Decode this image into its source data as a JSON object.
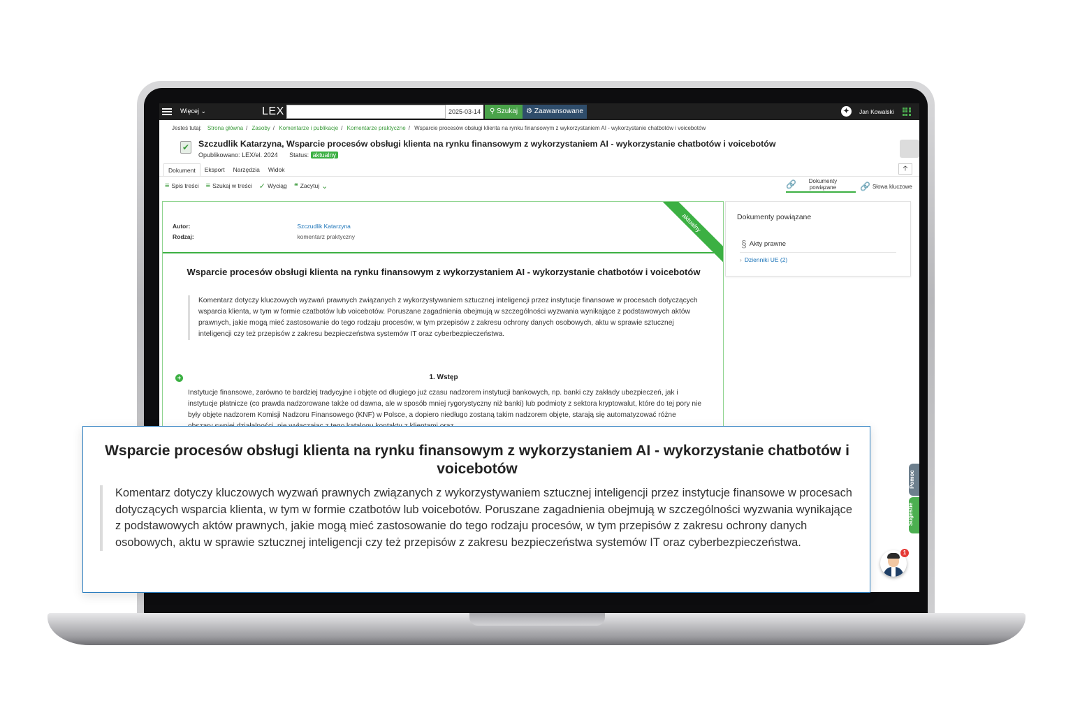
{
  "topbar": {
    "more_label": "Więcej ⌄",
    "logo": "LEX",
    "search_value": "",
    "date": "2025-03-14",
    "search_button": "Szukaj",
    "advanced_button": "Zaawansowane",
    "accessibility_icon": "accessibility-icon",
    "user_name": "Jan Kowalski",
    "apps_icon": "apps-grid-icon",
    "accent_color": "#4aa34a"
  },
  "breadcrumb": {
    "prefix": "Jesteś tutaj:",
    "items": [
      "Strona główna",
      "Zasoby",
      "Komentarze i publikacje",
      "Komentarze praktyczne"
    ],
    "current": "Wsparcie procesów obsługi klienta na rynku finansowym z wykorzystaniem AI - wykorzystanie chatbotów i voicebotów"
  },
  "document": {
    "header_title": "Szczudlik Katarzyna, Wsparcie procesów obsługi klienta na rynku finansowym z wykorzystaniem AI - wykorzystanie chatbotów i voicebotów",
    "published_label": "Opublikowano:",
    "published_value": "LEX/el. 2024",
    "status_label": "Status:",
    "status_value": "aktualny",
    "ribbon": "aktualny",
    "tabs": [
      "Dokument",
      "Eksport",
      "Narzędzia",
      "Widok"
    ],
    "toolbar": [
      "Spis treści",
      "Szukaj w treści",
      "Wyciąg",
      "Zacytuj"
    ],
    "right_tools": [
      "Dokumenty powiązane",
      "Słowa kluczowe"
    ],
    "author_label": "Autor:",
    "author_value": "Szczudlik Katarzyna",
    "kind_label": "Rodzaj:",
    "kind_value": "komentarz praktyczny",
    "title": "Wsparcie procesów obsługi klienta na rynku finansowym z wykorzystaniem AI - wykorzystanie chatbotów i voicebotów",
    "abstract": "Komentarz dotyczy kluczowych wyzwań prawnych związanych z wykorzystywaniem sztucznej inteligencji przez instytucje finansowe w procesach dotyczących wsparcia klienta, w tym w formie czatbotów lub voicebotów. Poruszane zagadnienia obejmują w szczególności wyzwania wynikające z podstawowych aktów prawnych, jakie mogą mieć zastosowanie do tego rodzaju procesów, w tym przepisów z zakresu ochrony danych osobowych, aktu w sprawie sztucznej inteligencji czy też przepisów z zakresu bezpieczeństwa systemów IT oraz cyberbezpieczeństwa.",
    "section_heading": "1. Wstęp",
    "body": "Instytucje finansowe, zarówno te bardziej tradycyjne i objęte od długiego już czasu nadzorem instytucji bankowych, np. banki czy zakłady ubezpieczeń, jak i instytucje płatnicze (co prawda nadzorowane także od dawna, ale w sposób mniej rygorystyczny niż banki) lub podmioty z sektora kryptowalut, które do tej pory nie były objęte nadzorem Komisji Nadzoru Finansowego (KNF) w Polsce, a dopiero niedługo zostaną takim nadzorem objęte, starają się automatyzować różne obszary swojej działalności, nie wyłączając z tego katalogu kontaktu z klientami oraz"
  },
  "side_panel": {
    "title": "Dokumenty powiązane",
    "acts_label": "Akty prawne",
    "link": "Dzienniki UE (2)"
  },
  "edge_tabs": {
    "help": "Pomoc",
    "suggestions": "Sugestie"
  },
  "assistant": {
    "badge_count": "1"
  },
  "zoom_callout": {
    "title": "Wsparcie procesów obsługi klienta na rynku finansowym z wykorzystaniem AI - wykorzystanie chatbotów i voicebotów",
    "abstract": "Komentarz dotyczy kluczowych wyzwań prawnych związanych z wykorzystywaniem sztucznej inteligencji przez instytucje finansowe w procesach dotyczących wsparcia klienta, w tym w formie czatbotów lub voicebotów. Poruszane zagadnienia obejmują w szczególności wyzwania wynikające z podstawowych aktów prawnych, jakie mogą mieć zastosowanie do tego rodzaju procesów, w tym przepisów z zakresu ochrony danych osobowych, aktu w sprawie sztucznej inteligencji czy też przepisów z zakresu bezpieczeństwa systemów IT oraz cyberbezpieczeństwa."
  }
}
